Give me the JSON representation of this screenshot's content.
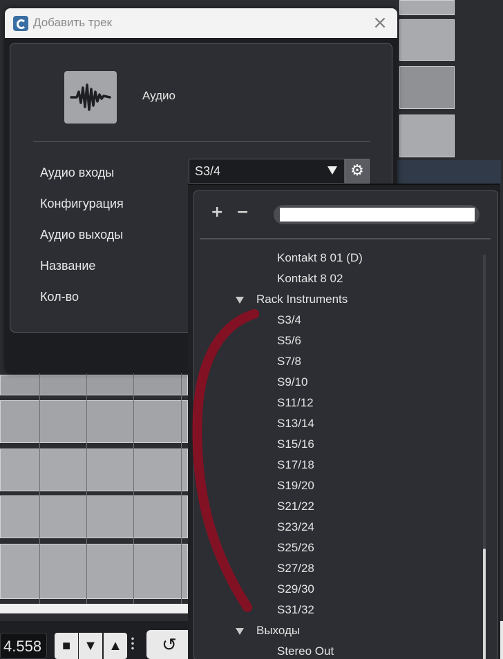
{
  "dialog": {
    "title": "Добавить трек",
    "close_glyph": "×",
    "track_type": "Аудио",
    "fields": {
      "inputs_label": "Аудио входы",
      "config_label": "Конфигурация",
      "outputs_label": "Аудио выходы",
      "name_label": "Название",
      "count_label": "Кол-во"
    },
    "input_value": "S3/4",
    "gear_glyph": "⚙"
  },
  "dropdown": {
    "add_glyph": "+",
    "remove_glyph": "−",
    "items": [
      {
        "label": "Kontakt 8 01 (D)",
        "level": 2
      },
      {
        "label": "Kontakt 8 02",
        "level": 2
      },
      {
        "label": "Rack Instruments",
        "level": 1,
        "expanded": true
      },
      {
        "label": "S3/4",
        "level": 2
      },
      {
        "label": "S5/6",
        "level": 2
      },
      {
        "label": "S7/8",
        "level": 2
      },
      {
        "label": "S9/10",
        "level": 2
      },
      {
        "label": "S11/12",
        "level": 2
      },
      {
        "label": "S13/14",
        "level": 2
      },
      {
        "label": "S15/16",
        "level": 2
      },
      {
        "label": "S17/18",
        "level": 2
      },
      {
        "label": "S19/20",
        "level": 2
      },
      {
        "label": "S21/22",
        "level": 2
      },
      {
        "label": "S23/24",
        "level": 2
      },
      {
        "label": "S25/26",
        "level": 2
      },
      {
        "label": "S27/28",
        "level": 2
      },
      {
        "label": "S29/30",
        "level": 2
      },
      {
        "label": "S31/32",
        "level": 2
      },
      {
        "label": "Выходы",
        "level": 1,
        "expanded": true
      },
      {
        "label": "Stereo Out",
        "level": 2
      }
    ]
  },
  "transport": {
    "position": "4.558",
    "lock_glyph": "🔒",
    "cycle_glyph": "↺"
  },
  "colors": {
    "annotation_stroke": "#8b0f23",
    "panel_bg": "#2c2e33",
    "text": "#e4e4e4"
  }
}
